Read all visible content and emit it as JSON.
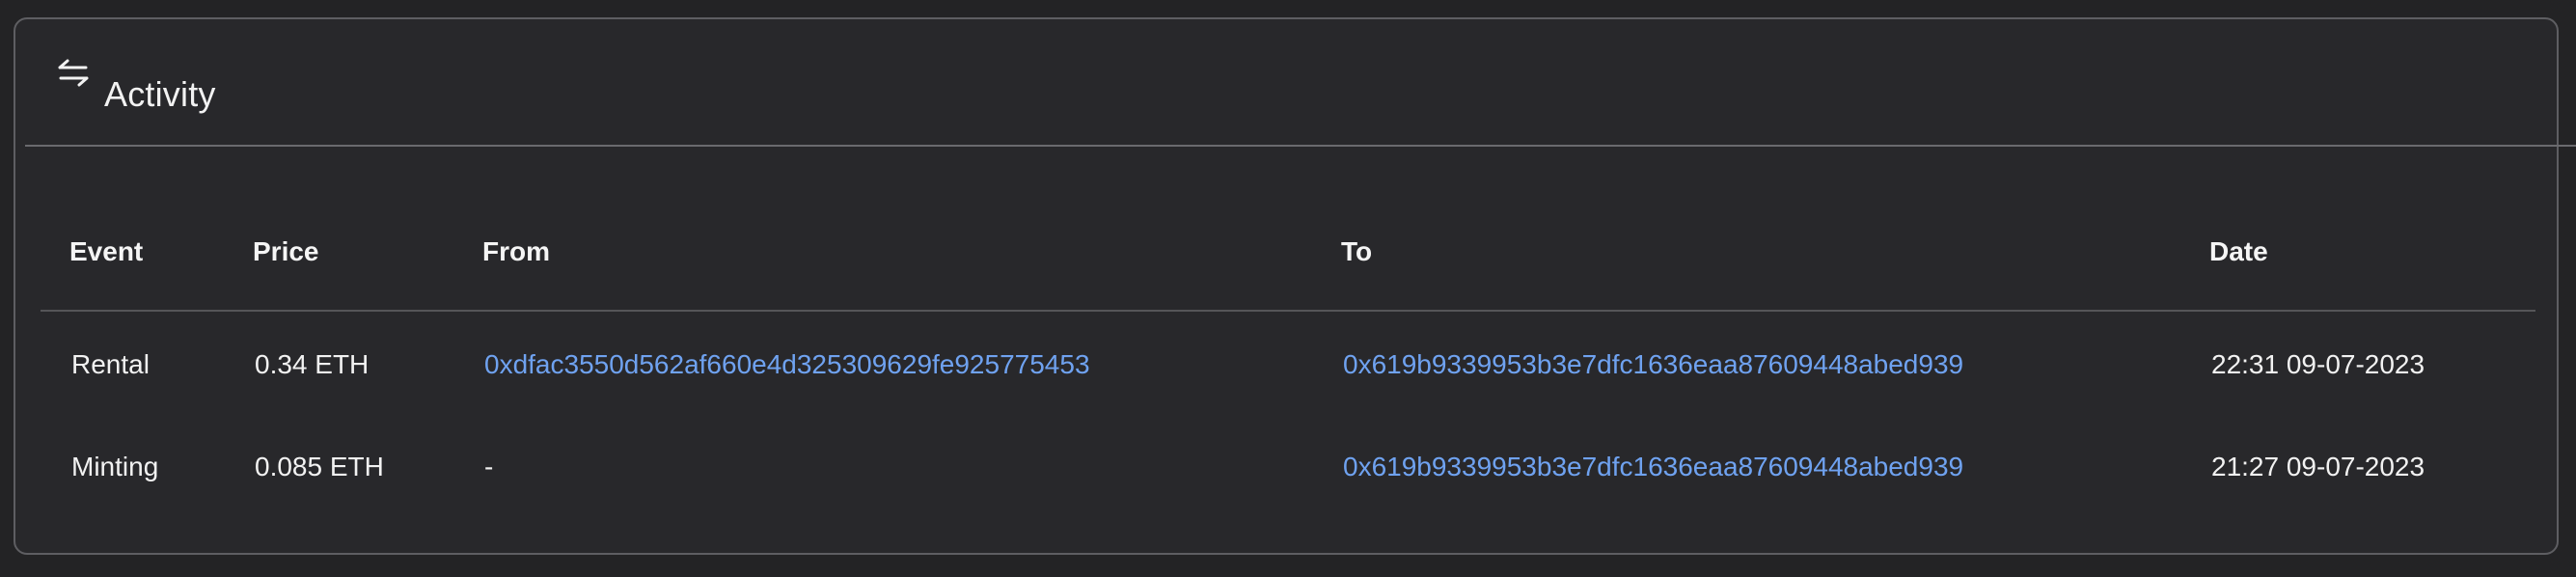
{
  "panel": {
    "title": "Activity",
    "icon": "swap-arrows-icon"
  },
  "table": {
    "columns": [
      "Event",
      "Price",
      "From",
      "To",
      "Date"
    ],
    "rows": [
      {
        "event": "Rental",
        "price": "0.34 ETH",
        "from": "0xdfac3550d562af660e4d325309629fe925775453",
        "to": "0x619b9339953b3e7dfc1636eaa87609448abed939",
        "date": "22:31 09-07-2023"
      },
      {
        "event": "Minting",
        "price": "0.085 ETH",
        "from": "-",
        "to": "0x619b9339953b3e7dfc1636eaa87609448abed939",
        "date": "21:27 09-07-2023"
      }
    ]
  },
  "colors": {
    "background": "#232325",
    "panel": "#28282b",
    "link": "#6fa2f0",
    "text": "#f2f2f2"
  }
}
